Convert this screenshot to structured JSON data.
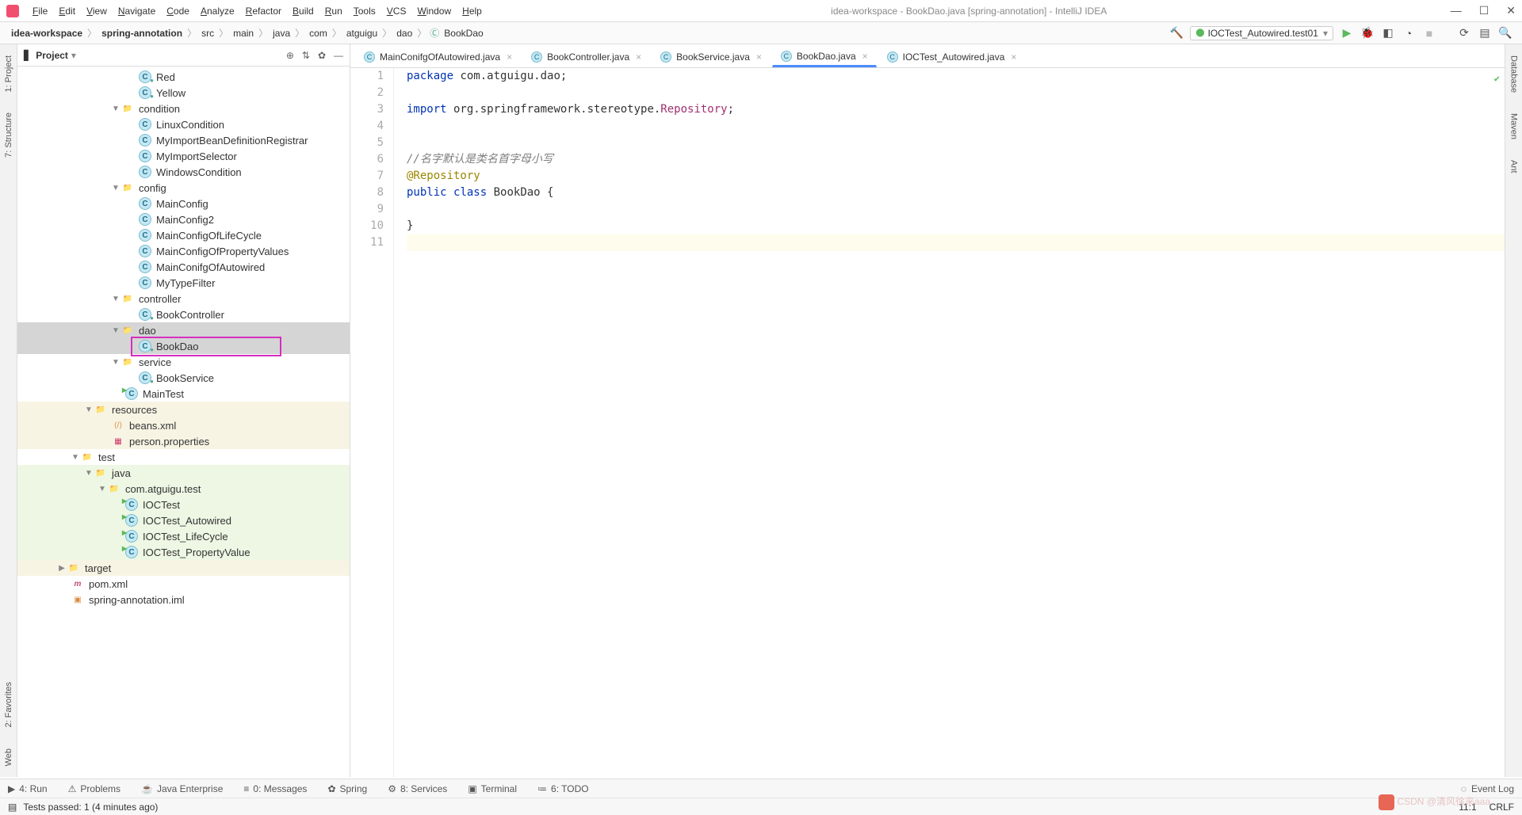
{
  "window": {
    "title": "idea-workspace - BookDao.java [spring-annotation] - IntelliJ IDEA"
  },
  "menu": {
    "items": [
      "File",
      "Edit",
      "View",
      "Navigate",
      "Code",
      "Analyze",
      "Refactor",
      "Build",
      "Run",
      "Tools",
      "VCS",
      "Window",
      "Help"
    ]
  },
  "breadcrumbs": [
    "idea-workspace",
    "spring-annotation",
    "src",
    "main",
    "java",
    "com",
    "atguigu",
    "dao",
    "BookDao"
  ],
  "runconfig": {
    "name": "IOCTest_Autowired.test01"
  },
  "project_panel": {
    "title": "Project"
  },
  "tree": [
    {
      "depth": 9,
      "icon": "class",
      "label": "Red",
      "sub": "a"
    },
    {
      "depth": 9,
      "icon": "class",
      "label": "Yellow",
      "sub": "a"
    },
    {
      "depth": 7,
      "icon": "folder",
      "label": "condition",
      "arrow": "down"
    },
    {
      "depth": 9,
      "icon": "class",
      "label": "LinuxCondition"
    },
    {
      "depth": 9,
      "icon": "class",
      "label": "MyImportBeanDefinitionRegistrar"
    },
    {
      "depth": 9,
      "icon": "class",
      "label": "MyImportSelector"
    },
    {
      "depth": 9,
      "icon": "class",
      "label": "WindowsCondition"
    },
    {
      "depth": 7,
      "icon": "folder",
      "label": "config",
      "arrow": "down"
    },
    {
      "depth": 9,
      "icon": "class",
      "label": "MainConfig"
    },
    {
      "depth": 9,
      "icon": "class",
      "label": "MainConfig2"
    },
    {
      "depth": 9,
      "icon": "class",
      "label": "MainConfigOfLifeCycle"
    },
    {
      "depth": 9,
      "icon": "class",
      "label": "MainConfigOfPropertyValues"
    },
    {
      "depth": 9,
      "icon": "class",
      "label": "MainConifgOfAutowired"
    },
    {
      "depth": 9,
      "icon": "class",
      "label": "MyTypeFilter"
    },
    {
      "depth": 7,
      "icon": "folder",
      "label": "controller",
      "arrow": "down"
    },
    {
      "depth": 9,
      "icon": "class",
      "label": "BookController",
      "sub": "a"
    },
    {
      "depth": 7,
      "icon": "folder",
      "label": "dao",
      "arrow": "down",
      "sel": true
    },
    {
      "depth": 9,
      "icon": "class",
      "label": "BookDao",
      "sub": "a",
      "sel": true,
      "boxed": true
    },
    {
      "depth": 7,
      "icon": "folder",
      "label": "service",
      "arrow": "down"
    },
    {
      "depth": 9,
      "icon": "class",
      "label": "BookService",
      "sub": "a"
    },
    {
      "depth": 8,
      "icon": "class",
      "label": "MainTest",
      "run": true
    },
    {
      "depth": 5,
      "icon": "resfolder",
      "label": "resources",
      "arrow": "down",
      "bg": "res"
    },
    {
      "depth": 7,
      "icon": "xml",
      "label": "beans.xml",
      "bg": "res"
    },
    {
      "depth": 7,
      "icon": "prop",
      "label": "person.properties",
      "bg": "res"
    },
    {
      "depth": 4,
      "icon": "folder",
      "label": "test",
      "arrow": "down"
    },
    {
      "depth": 5,
      "icon": "testfolder",
      "label": "java",
      "arrow": "down",
      "bg": "test"
    },
    {
      "depth": 6,
      "icon": "folder",
      "label": "com.atguigu.test",
      "arrow": "down",
      "bg": "test"
    },
    {
      "depth": 8,
      "icon": "class",
      "label": "IOCTest",
      "run": true,
      "bg": "test"
    },
    {
      "depth": 8,
      "icon": "class",
      "label": "IOCTest_Autowired",
      "run": true,
      "bg": "test"
    },
    {
      "depth": 8,
      "icon": "class",
      "label": "IOCTest_LifeCycle",
      "run": true,
      "bg": "test"
    },
    {
      "depth": 8,
      "icon": "class",
      "label": "IOCTest_PropertyValue",
      "run": true,
      "bg": "test"
    },
    {
      "depth": 3,
      "icon": "exfolder",
      "label": "target",
      "arrow": "right",
      "bg": "res"
    },
    {
      "depth": 4,
      "icon": "pom",
      "label": "pom.xml"
    },
    {
      "depth": 4,
      "icon": "iml",
      "label": "spring-annotation.iml"
    }
  ],
  "tabs": [
    {
      "label": "MainConifgOfAutowired.java",
      "active": false
    },
    {
      "label": "BookController.java",
      "active": false
    },
    {
      "label": "BookService.java",
      "active": false
    },
    {
      "label": "BookDao.java",
      "active": true
    },
    {
      "label": "IOCTest_Autowired.java",
      "active": false
    }
  ],
  "code": {
    "1": {
      "t": "package com.atguigu.dao;",
      "k": "package",
      "rest": " com.atguigu.dao;"
    },
    "3": {
      "t": "import org.springframework.stereotype.Repository;",
      "k": "import",
      "rest": " org.springframework.stereotype.",
      "cls": "Repository",
      "tail": ";"
    },
    "6": "//名字默认是类名首字母小写",
    "7": "@Repository",
    "8": {
      "kw1": "public",
      "kw2": "class",
      "name": " BookDao {",
      "rest": ""
    },
    "10": "}"
  },
  "left_tabs": [
    "1: Project",
    "7: Structure",
    "2: Favorites",
    "Web"
  ],
  "right_tabs": [
    "Database",
    "Maven",
    "Ant"
  ],
  "bottom_tabs": [
    {
      "icon": "▶",
      "label": "4: Run"
    },
    {
      "icon": "⚠",
      "label": "Problems"
    },
    {
      "icon": "☕",
      "label": "Java Enterprise"
    },
    {
      "icon": "≡",
      "label": "0: Messages"
    },
    {
      "icon": "✿",
      "label": "Spring"
    },
    {
      "icon": "⚙",
      "label": "8: Services"
    },
    {
      "icon": "▣",
      "label": "Terminal"
    },
    {
      "icon": "≔",
      "label": "6: TODO"
    }
  ],
  "event_log": "Event Log",
  "status": {
    "left": "Tests passed: 1 (4 minutes ago)",
    "pos": "11:1",
    "crlf": "CRLF"
  },
  "watermark": "CSDN @清风徐来aaa"
}
